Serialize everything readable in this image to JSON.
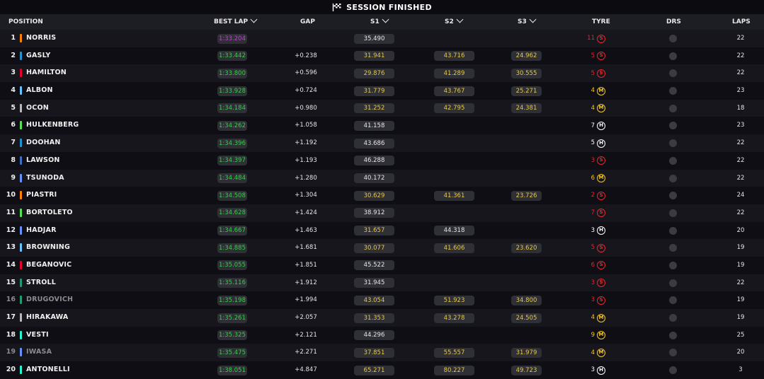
{
  "banner": {
    "title": "SESSION FINISHED",
    "icon": "checkered-flag-icon"
  },
  "headers": {
    "position": "POSITION",
    "best_lap": "BEST LAP",
    "gap": "GAP",
    "s1": "S1",
    "s2": "S2",
    "s3": "S3",
    "tyre": "TYRE",
    "drs": "DRS",
    "laps": "LAPS"
  },
  "colors": {
    "tyre_soft": "#e8262a",
    "tyre_medium": "#f2c823",
    "tyre_hard": "#ffffff",
    "fastest_lap": "#c240d8",
    "personal_best": "#35d04a",
    "sector_yellow": "#e6c84a"
  },
  "rows": [
    {
      "pos": "1",
      "name": "NORRIS",
      "team_color": "#ff8000",
      "best": "1:33.204",
      "best_fastest": true,
      "gap": "",
      "s1": "35.490",
      "s1c": "white",
      "s2": "",
      "s2c": "",
      "s3": "",
      "s3c": "",
      "tyre_laps": "11",
      "tyre_laps_c": "#e8262a",
      "tyre": "S",
      "laps": "22",
      "dim": false
    },
    {
      "pos": "2",
      "name": "GASLY",
      "team_color": "#2293d1",
      "best": "1:33.442",
      "best_fastest": false,
      "gap": "+0.238",
      "s1": "31.941",
      "s1c": "yellow",
      "s2": "43.716",
      "s2c": "yellow",
      "s3": "24.962",
      "s3c": "yellow",
      "tyre_laps": "5",
      "tyre_laps_c": "#e8262a",
      "tyre": "S",
      "laps": "22",
      "dim": false
    },
    {
      "pos": "3",
      "name": "HAMILTON",
      "team_color": "#e8002d",
      "best": "1:33.800",
      "best_fastest": false,
      "gap": "+0.596",
      "s1": "29.876",
      "s1c": "yellow",
      "s2": "41.289",
      "s2c": "yellow",
      "s3": "30.555",
      "s3c": "yellow",
      "tyre_laps": "5",
      "tyre_laps_c": "#e8262a",
      "tyre": "S",
      "laps": "22",
      "dim": false
    },
    {
      "pos": "4",
      "name": "ALBON",
      "team_color": "#64c4ff",
      "best": "1:33.928",
      "best_fastest": false,
      "gap": "+0.724",
      "s1": "31.779",
      "s1c": "yellow",
      "s2": "43.767",
      "s2c": "yellow",
      "s3": "25.271",
      "s3c": "yellow",
      "tyre_laps": "4",
      "tyre_laps_c": "#f2c823",
      "tyre": "M",
      "laps": "23",
      "dim": false
    },
    {
      "pos": "5",
      "name": "OCON",
      "team_color": "#b6babd",
      "best": "1:34.184",
      "best_fastest": false,
      "gap": "+0.980",
      "s1": "31.252",
      "s1c": "yellow",
      "s2": "42.795",
      "s2c": "yellow",
      "s3": "24.381",
      "s3c": "yellow",
      "tyre_laps": "4",
      "tyre_laps_c": "#f2c823",
      "tyre": "M",
      "laps": "18",
      "dim": false
    },
    {
      "pos": "6",
      "name": "HULKENBERG",
      "team_color": "#52e252",
      "best": "1:34.262",
      "best_fastest": false,
      "gap": "+1.058",
      "s1": "41.158",
      "s1c": "white",
      "s2": "",
      "s2c": "",
      "s3": "",
      "s3c": "",
      "tyre_laps": "7",
      "tyre_laps_c": "#ffffff",
      "tyre": "H",
      "laps": "23",
      "dim": false
    },
    {
      "pos": "7",
      "name": "DOOHAN",
      "team_color": "#2293d1",
      "best": "1:34.396",
      "best_fastest": false,
      "gap": "+1.192",
      "s1": "43.686",
      "s1c": "white",
      "s2": "",
      "s2c": "",
      "s3": "",
      "s3c": "",
      "tyre_laps": "5",
      "tyre_laps_c": "#ffffff",
      "tyre": "H",
      "laps": "22",
      "dim": false
    },
    {
      "pos": "8",
      "name": "LAWSON",
      "team_color": "#3671c6",
      "best": "1:34.397",
      "best_fastest": false,
      "gap": "+1.193",
      "s1": "46.288",
      "s1c": "white",
      "s2": "",
      "s2c": "",
      "s3": "",
      "s3c": "",
      "tyre_laps": "3",
      "tyre_laps_c": "#e8262a",
      "tyre": "S",
      "laps": "22",
      "dim": false
    },
    {
      "pos": "9",
      "name": "TSUNODA",
      "team_color": "#6692ff",
      "best": "1:34.484",
      "best_fastest": false,
      "gap": "+1.280",
      "s1": "40.172",
      "s1c": "white",
      "s2": "",
      "s2c": "",
      "s3": "",
      "s3c": "",
      "tyre_laps": "6",
      "tyre_laps_c": "#f2c823",
      "tyre": "M",
      "laps": "22",
      "dim": false
    },
    {
      "pos": "10",
      "name": "PIASTRI",
      "team_color": "#ff8000",
      "best": "1:34.508",
      "best_fastest": false,
      "gap": "+1.304",
      "s1": "30.629",
      "s1c": "yellow",
      "s2": "41.361",
      "s2c": "yellow",
      "s3": "23.726",
      "s3c": "yellow",
      "tyre_laps": "2",
      "tyre_laps_c": "#e8262a",
      "tyre": "S",
      "laps": "24",
      "dim": false
    },
    {
      "pos": "11",
      "name": "BORTOLETO",
      "team_color": "#52e252",
      "best": "1:34.628",
      "best_fastest": false,
      "gap": "+1.424",
      "s1": "38.912",
      "s1c": "white",
      "s2": "",
      "s2c": "",
      "s3": "",
      "s3c": "",
      "tyre_laps": "7",
      "tyre_laps_c": "#e8262a",
      "tyre": "S",
      "laps": "22",
      "dim": false
    },
    {
      "pos": "12",
      "name": "HADJAR",
      "team_color": "#6692ff",
      "best": "1:34.667",
      "best_fastest": false,
      "gap": "+1.463",
      "s1": "31.657",
      "s1c": "yellow",
      "s2": "44.318",
      "s2c": "white",
      "s3": "",
      "s3c": "",
      "tyre_laps": "3",
      "tyre_laps_c": "#ffffff",
      "tyre": "H",
      "laps": "20",
      "dim": false
    },
    {
      "pos": "13",
      "name": "BROWNING",
      "team_color": "#64c4ff",
      "best": "1:34.885",
      "best_fastest": false,
      "gap": "+1.681",
      "s1": "30.077",
      "s1c": "yellow",
      "s2": "41.606",
      "s2c": "yellow",
      "s3": "23.620",
      "s3c": "yellow",
      "tyre_laps": "5",
      "tyre_laps_c": "#e8262a",
      "tyre": "S",
      "laps": "19",
      "dim": false
    },
    {
      "pos": "14",
      "name": "BEGANOVIC",
      "team_color": "#e8002d",
      "best": "1:35.055",
      "best_fastest": false,
      "gap": "+1.851",
      "s1": "45.522",
      "s1c": "white",
      "s2": "",
      "s2c": "",
      "s3": "",
      "s3c": "",
      "tyre_laps": "6",
      "tyre_laps_c": "#e8262a",
      "tyre": "S",
      "laps": "19",
      "dim": false
    },
    {
      "pos": "15",
      "name": "STROLL",
      "team_color": "#229971",
      "best": "1:35.116",
      "best_fastest": false,
      "gap": "+1.912",
      "s1": "31.945",
      "s1c": "white",
      "s2": "",
      "s2c": "",
      "s3": "",
      "s3c": "",
      "tyre_laps": "3",
      "tyre_laps_c": "#e8262a",
      "tyre": "S",
      "laps": "22",
      "dim": false
    },
    {
      "pos": "16",
      "name": "DRUGOVICH",
      "team_color": "#229971",
      "best": "1:35.198",
      "best_fastest": false,
      "gap": "+1.994",
      "s1": "43.054",
      "s1c": "yellow",
      "s2": "51.923",
      "s2c": "yellow",
      "s3": "34.800",
      "s3c": "yellow",
      "tyre_laps": "3",
      "tyre_laps_c": "#e8262a",
      "tyre": "S",
      "laps": "19",
      "dim": true
    },
    {
      "pos": "17",
      "name": "HIRAKAWA",
      "team_color": "#b6babd",
      "best": "1:35.261",
      "best_fastest": false,
      "gap": "+2.057",
      "s1": "31.353",
      "s1c": "yellow",
      "s2": "43.278",
      "s2c": "yellow",
      "s3": "24.505",
      "s3c": "yellow",
      "tyre_laps": "4",
      "tyre_laps_c": "#f2c823",
      "tyre": "M",
      "laps": "19",
      "dim": false
    },
    {
      "pos": "18",
      "name": "VESTI",
      "team_color": "#27f4d2",
      "best": "1:35.325",
      "best_fastest": false,
      "gap": "+2.121",
      "s1": "44.296",
      "s1c": "white",
      "s2": "",
      "s2c": "",
      "s3": "",
      "s3c": "",
      "tyre_laps": "9",
      "tyre_laps_c": "#f2c823",
      "tyre": "M",
      "laps": "25",
      "dim": false
    },
    {
      "pos": "19",
      "name": "IWASA",
      "team_color": "#6692ff",
      "best": "1:35.475",
      "best_fastest": false,
      "gap": "+2.271",
      "s1": "37.851",
      "s1c": "yellow",
      "s2": "55.557",
      "s2c": "yellow",
      "s3": "31.979",
      "s3c": "yellow",
      "tyre_laps": "4",
      "tyre_laps_c": "#f2c823",
      "tyre": "M",
      "laps": "20",
      "dim": true
    },
    {
      "pos": "20",
      "name": "ANTONELLI",
      "team_color": "#27f4d2",
      "best": "1:38.051",
      "best_fastest": false,
      "gap": "+4.847",
      "s1": "65.271",
      "s1c": "yellow",
      "s2": "80.227",
      "s2c": "yellow",
      "s3": "49.723",
      "s3c": "yellow",
      "tyre_laps": "3",
      "tyre_laps_c": "#ffffff",
      "tyre": "H",
      "laps": "3",
      "dim": false
    }
  ]
}
